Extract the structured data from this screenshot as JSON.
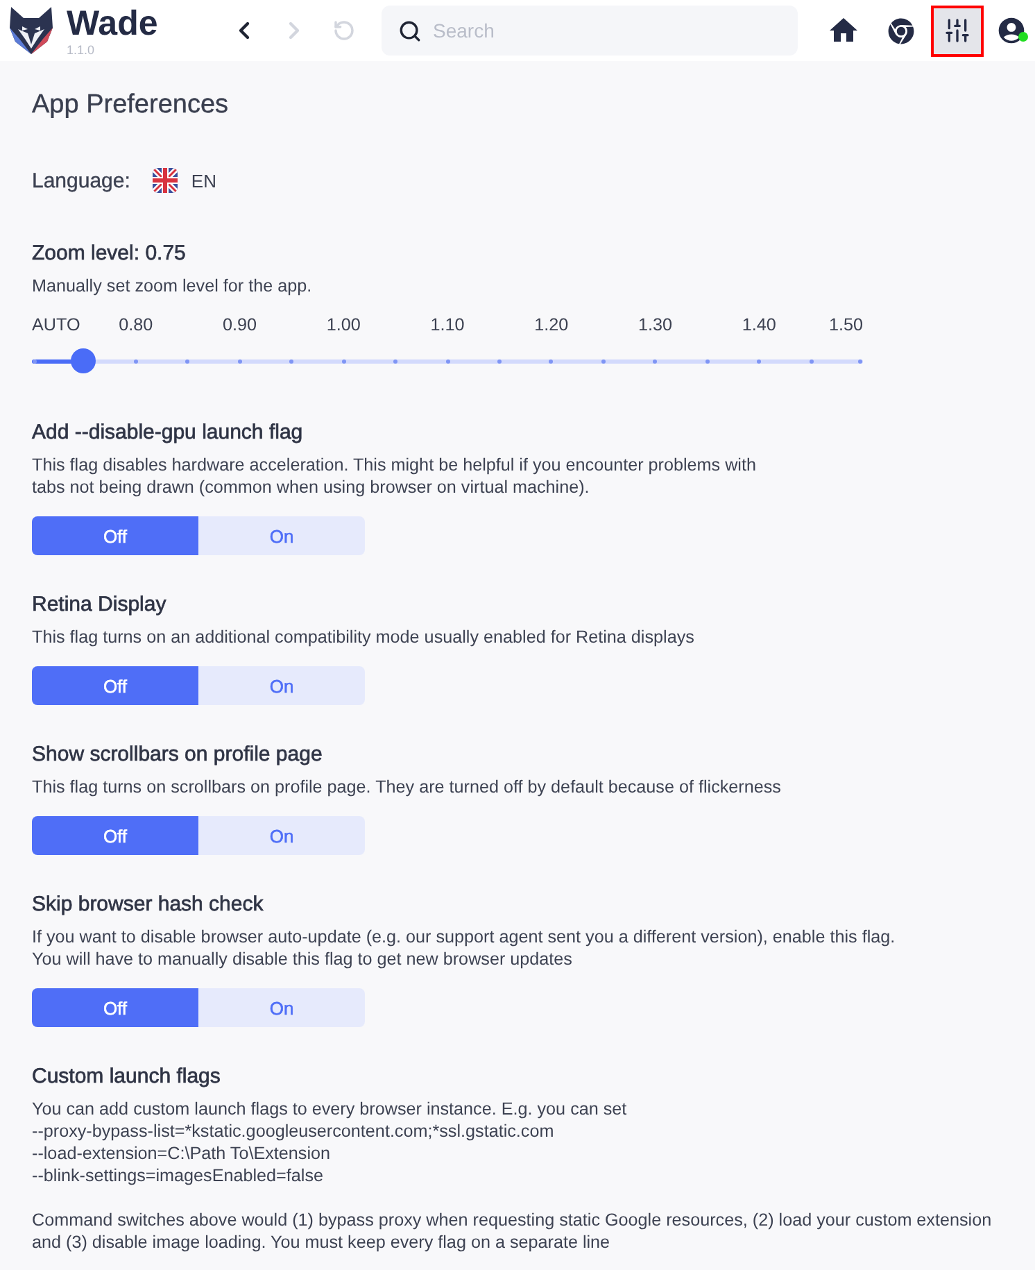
{
  "app": {
    "name": "Wade",
    "version": "1.1.0"
  },
  "toolbar": {
    "nav": [
      {
        "kind": "back",
        "disabled": false
      },
      {
        "kind": "forward",
        "disabled": true
      },
      {
        "kind": "reload",
        "disabled": true
      }
    ],
    "search": {
      "placeholder": "Search"
    },
    "buttons": [
      {
        "kind": "home",
        "selected": false
      },
      {
        "kind": "browser",
        "selected": false
      },
      {
        "kind": "settings",
        "selected": true
      },
      {
        "kind": "profile",
        "selected": false,
        "online": true
      }
    ]
  },
  "page": {
    "title": "App Preferences",
    "language": {
      "label": "Language:",
      "value": "EN"
    },
    "zoom": {
      "title": "Zoom level: 0.75",
      "description": "Manually set zoom level for the app.",
      "ticks": [
        "AUTO",
        "0.80",
        "0.90",
        "1.00",
        "1.10",
        "1.20",
        "1.30",
        "1.40",
        "1.50"
      ],
      "level": 0.0625
    },
    "flags": [
      {
        "title": "Add --disable-gpu launch flag",
        "description": "This flag disables hardware acceleration. This might be helpful if you encounter problems with\ntabs not being drawn (common when using browser on virtual machine).",
        "options": [
          {
            "label": "Off",
            "selected": true
          },
          {
            "label": "On",
            "selected": false
          }
        ]
      },
      {
        "title": "Retina Display",
        "description": "This flag turns on an additional compatibility mode usually enabled for Retina displays",
        "options": [
          {
            "label": "Off",
            "selected": true
          },
          {
            "label": "On",
            "selected": false
          }
        ]
      },
      {
        "title": "Show scrollbars on profile page",
        "description": "This flag turns on scrollbars on profile page. They are turned off by default because of flickerness",
        "options": [
          {
            "label": "Off",
            "selected": true
          },
          {
            "label": "On",
            "selected": false
          }
        ]
      },
      {
        "title": "Skip browser hash check",
        "description": "If you want to disable browser auto-update (e.g. our support agent sent you a different version), enable this flag.\nYou will have to manually disable this flag to get new browser updates",
        "options": [
          {
            "label": "Off",
            "selected": true
          },
          {
            "label": "On",
            "selected": false
          }
        ]
      }
    ],
    "custom_flags": {
      "title": "Custom launch flags",
      "lines": [
        "You can add custom launch flags to every browser instance. E.g. you can set",
        "--proxy-bypass-list=*kstatic.googleusercontent.com;*ssl.gstatic.com",
        "--load-extension=C:\\Path To\\Extension",
        "--blink-settings=imagesEnabled=false"
      ],
      "note": "Command switches above would (1) bypass proxy when requesting static Google resources, (2) load your custom extension\nand (3) disable image loading. You must keep every flag on a separate line"
    }
  }
}
